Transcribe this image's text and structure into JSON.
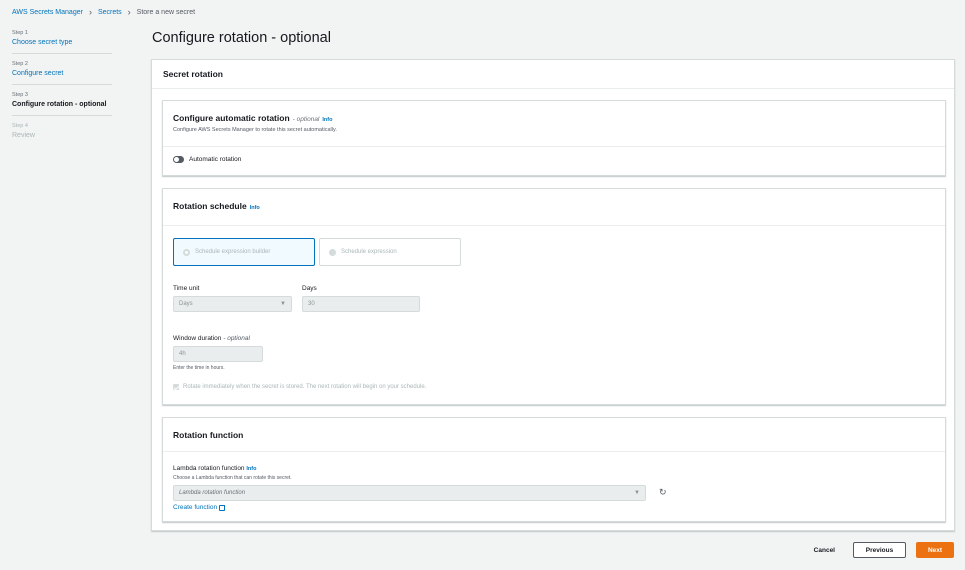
{
  "breadcrumb": {
    "items": [
      "AWS Secrets Manager",
      "Secrets",
      "Store a new secret"
    ]
  },
  "steps": [
    {
      "num": "Step 1",
      "label": "Choose secret type"
    },
    {
      "num": "Step 2",
      "label": "Configure secret"
    },
    {
      "num": "Step 3",
      "label": "Configure rotation - optional"
    },
    {
      "num": "Step 4",
      "label": "Review"
    }
  ],
  "page": {
    "title": "Configure rotation - optional"
  },
  "secret_rotation": {
    "title": "Secret rotation"
  },
  "auto_rotation": {
    "title": "Configure automatic rotation",
    "optional": "- optional",
    "info": "Info",
    "description": "Configure AWS Secrets Manager to rotate this secret automatically.",
    "toggle_label": "Automatic rotation",
    "toggle_on": false
  },
  "schedule": {
    "title": "Rotation schedule",
    "info": "Info",
    "option_builder": "Schedule expression builder",
    "option_expression": "Schedule expression",
    "time_unit_label": "Time unit",
    "time_unit_value": "Days",
    "days_label": "Days",
    "days_value": "30",
    "window_label": "Window duration",
    "window_optional": "- optional",
    "window_value": "4h",
    "window_hint": "Enter the time in hours.",
    "rotate_immediately": "Rotate immediately when the secret is stored. The next rotation will begin on your schedule."
  },
  "function": {
    "title": "Rotation function",
    "lambda_label": "Lambda rotation function",
    "info": "Info",
    "lambda_hint": "Choose a Lambda function that can rotate this secret.",
    "lambda_placeholder": "Lambda rotation function",
    "create_link": "Create function"
  },
  "footer": {
    "cancel": "Cancel",
    "previous": "Previous",
    "next": "Next"
  },
  "colors": {
    "link": "#0073bb",
    "primary": "#ec7211",
    "background": "#f2f3f3"
  }
}
